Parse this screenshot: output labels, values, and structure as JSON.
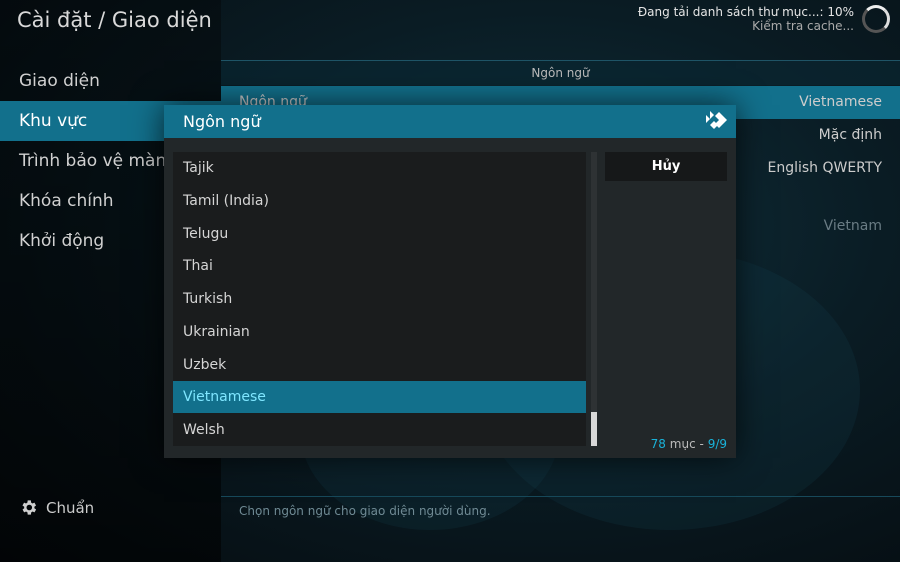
{
  "header": {
    "title": "Cài đặt / Giao diện",
    "status_line1": "Đang tải danh sách thư mục...: 10%",
    "status_line2": "Kiểm tra cache..."
  },
  "sidebar": {
    "items": [
      {
        "label": "Giao diện"
      },
      {
        "label": "Khu vực"
      },
      {
        "label": "Trình bảo vệ màn hình"
      },
      {
        "label": "Khóa chính"
      },
      {
        "label": "Khởi động"
      }
    ],
    "footer_label": "Chuẩn"
  },
  "panel": {
    "header": "Ngôn ngữ",
    "rows": [
      {
        "label": "Ngôn ngữ",
        "value": "Vietnamese"
      },
      {
        "label": "",
        "value": "Mặc định"
      },
      {
        "label": "",
        "value": "English QWERTY"
      },
      {
        "label": "",
        "value": "Vietnam"
      }
    ],
    "footer": "Chọn ngôn ngữ cho giao diện người dùng."
  },
  "dialog": {
    "title": "Ngôn ngữ",
    "items": [
      "Tajik",
      "Tamil (India)",
      "Telugu",
      "Thai",
      "Turkish",
      "Ukrainian",
      "Uzbek",
      "Vietnamese",
      "Welsh"
    ],
    "selected": "Vietnamese",
    "cancel_label": "Hủy",
    "count_number": "78",
    "count_word": "mục",
    "count_sep": "-",
    "count_page": "9/9"
  },
  "colors": {
    "accent": "#12708c",
    "highlight_text": "#7fe6ff",
    "count_accent": "#19b2d9"
  },
  "icons": {
    "footer": "gear-icon",
    "dialog_logo": "kodi-logo-icon",
    "loading": "spinner-icon"
  }
}
